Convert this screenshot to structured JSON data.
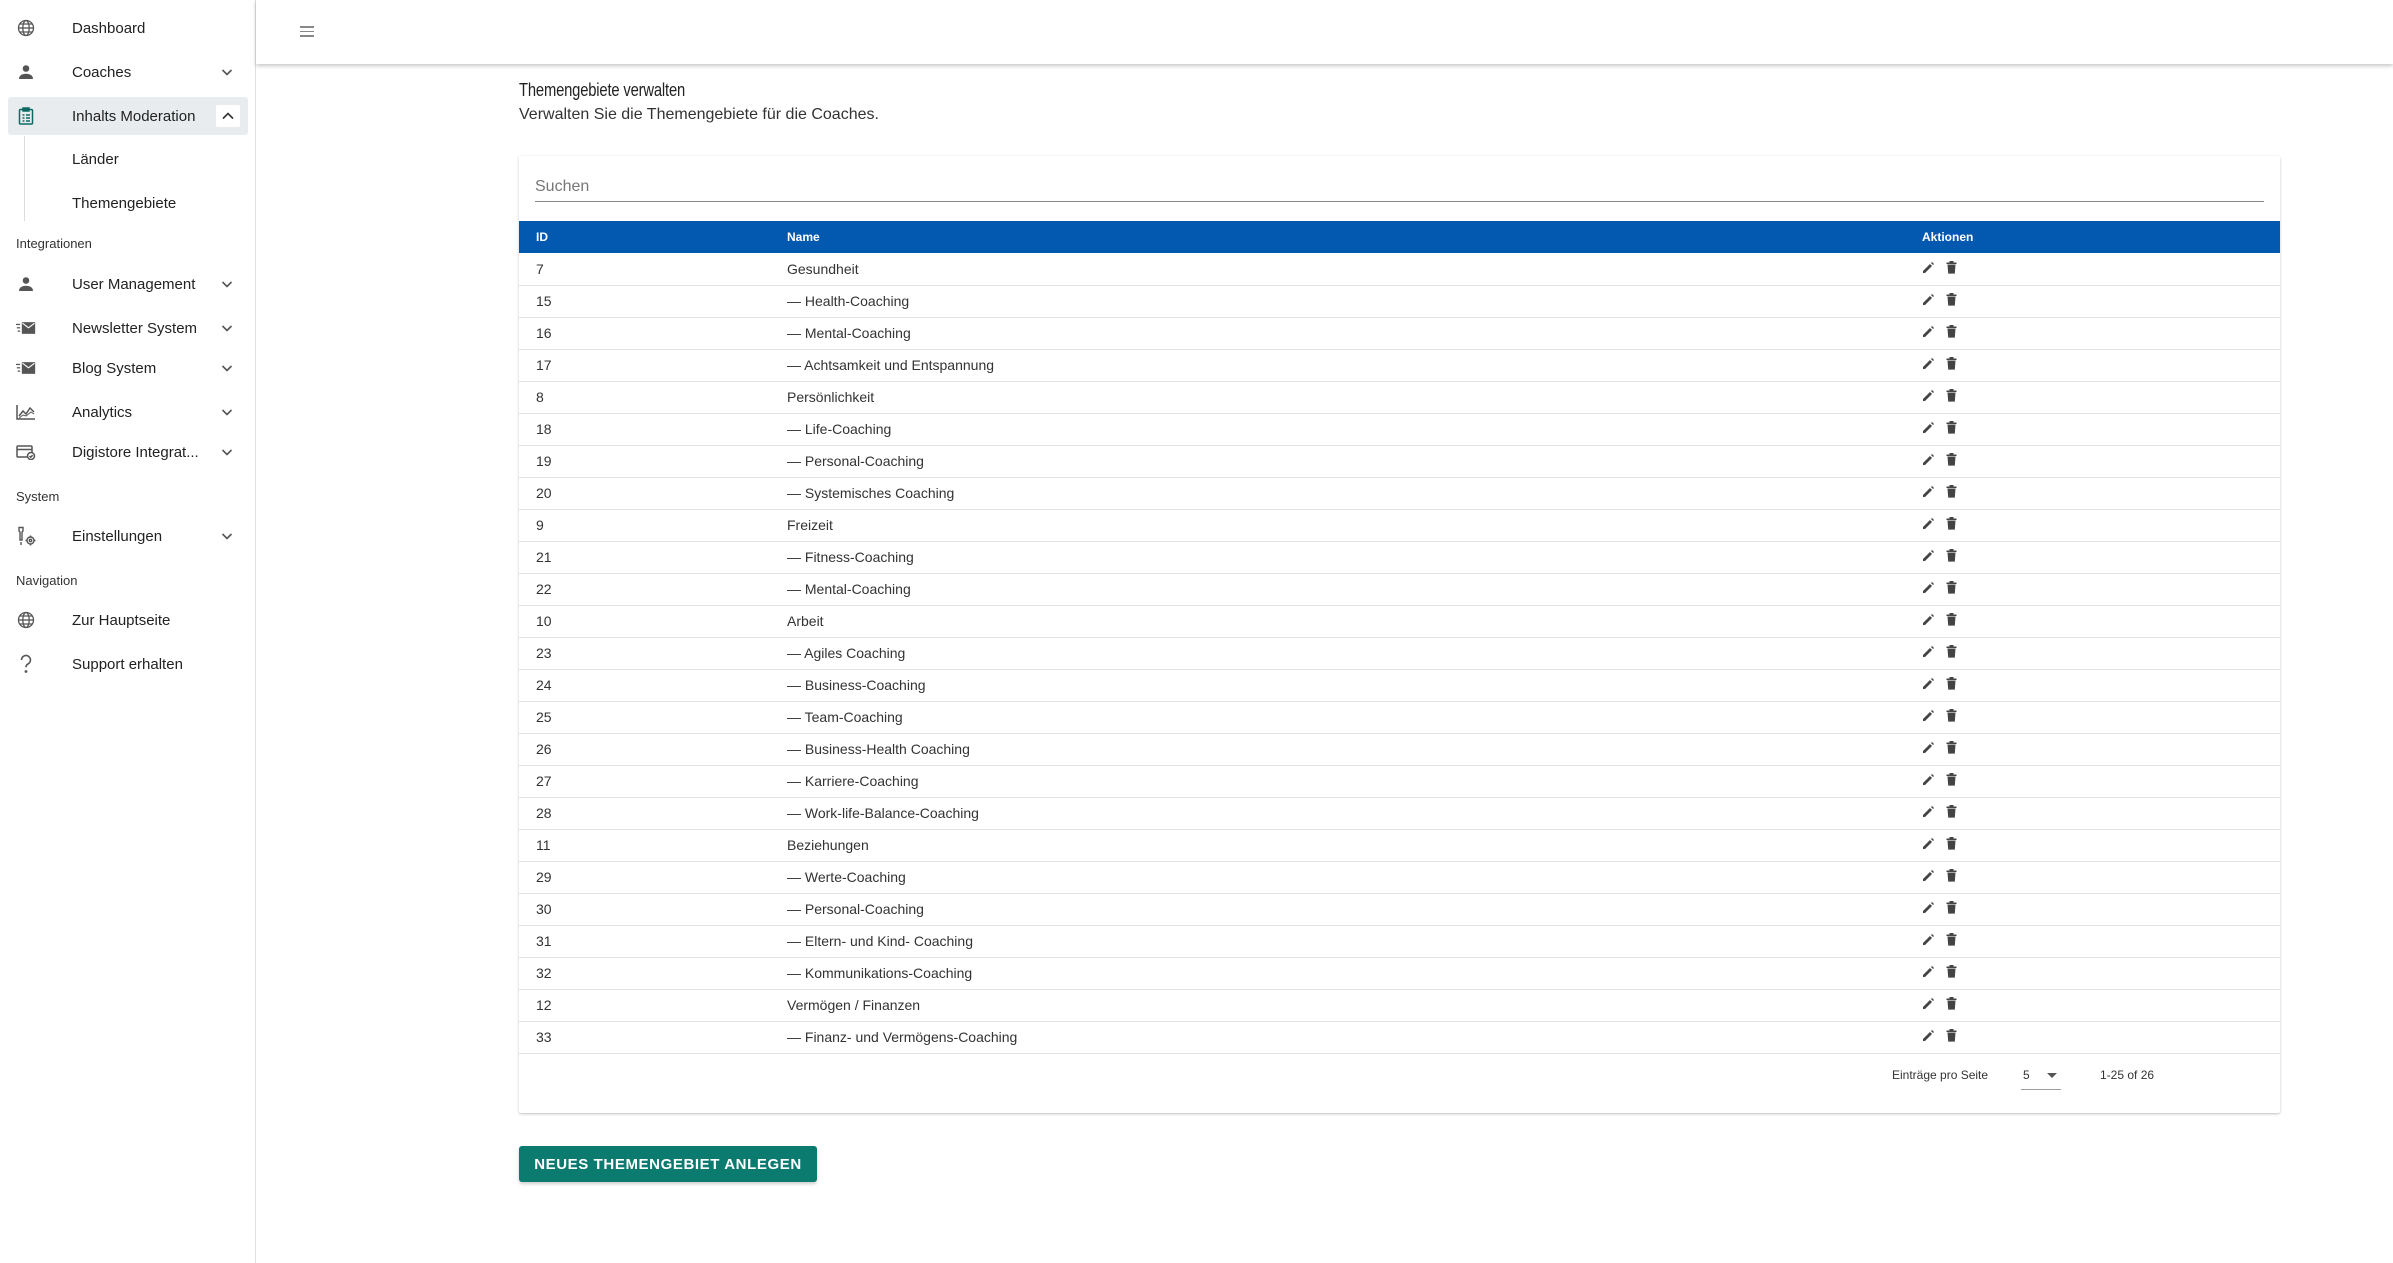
{
  "sidebar": {
    "items": [
      {
        "label": "Dashboard",
        "icon": "globe-icon",
        "expandable": false
      },
      {
        "label": "Coaches",
        "icon": "person-icon",
        "expandable": true
      },
      {
        "label": "Inhalts Moderation",
        "icon": "clipboard-icon",
        "expandable": true,
        "expanded": true,
        "children": [
          "Länder",
          "Themengebiete"
        ]
      }
    ],
    "sections": [
      {
        "label": "Integrationen",
        "items": [
          {
            "label": "User Management",
            "icon": "person-icon"
          },
          {
            "label": "Newsletter System",
            "icon": "mail-icon"
          },
          {
            "label": "Blog System",
            "icon": "mail-icon"
          },
          {
            "label": "Analytics",
            "icon": "chart-icon"
          },
          {
            "label": "Digistore Integrat...",
            "icon": "card-icon"
          }
        ]
      },
      {
        "label": "System",
        "items": [
          {
            "label": "Einstellungen",
            "icon": "tools-icon"
          }
        ]
      },
      {
        "label": "Navigation",
        "items": [
          {
            "label": "Zur Hauptseite",
            "icon": "globe-icon"
          },
          {
            "label": "Support erhalten",
            "icon": "question-icon"
          }
        ]
      }
    ]
  },
  "page": {
    "title": "Themengebiete verwalten",
    "subtitle": "Verwalten Sie die Themengebiete für die Coaches."
  },
  "search": {
    "placeholder": "Suchen",
    "value": ""
  },
  "table": {
    "columns": [
      "ID",
      "Name",
      "Aktionen"
    ],
    "rows": [
      {
        "id": "7",
        "name": "Gesundheit"
      },
      {
        "id": "15",
        "name": "— Health-Coaching"
      },
      {
        "id": "16",
        "name": "— Mental-Coaching"
      },
      {
        "id": "17",
        "name": "— Achtsamkeit und Entspannung"
      },
      {
        "id": "8",
        "name": "Persönlichkeit"
      },
      {
        "id": "18",
        "name": "— Life-Coaching"
      },
      {
        "id": "19",
        "name": "— Personal-Coaching"
      },
      {
        "id": "20",
        "name": "— Systemisches Coaching"
      },
      {
        "id": "9",
        "name": "Freizeit"
      },
      {
        "id": "21",
        "name": "— Fitness-Coaching"
      },
      {
        "id": "22",
        "name": "— Mental-Coaching"
      },
      {
        "id": "10",
        "name": "Arbeit"
      },
      {
        "id": "23",
        "name": "— Agiles Coaching"
      },
      {
        "id": "24",
        "name": "— Business-Coaching"
      },
      {
        "id": "25",
        "name": "— Team-Coaching"
      },
      {
        "id": "26",
        "name": "— Business-Health Coaching"
      },
      {
        "id": "27",
        "name": "— Karriere-Coaching"
      },
      {
        "id": "28",
        "name": "— Work-life-Balance-Coaching"
      },
      {
        "id": "11",
        "name": "Beziehungen"
      },
      {
        "id": "29",
        "name": "— Werte-Coaching"
      },
      {
        "id": "30",
        "name": "— Personal-Coaching"
      },
      {
        "id": "31",
        "name": "— Eltern- und Kind- Coaching"
      },
      {
        "id": "32",
        "name": "— Kommunikations-Coaching"
      },
      {
        "id": "12",
        "name": "Vermögen / Finanzen"
      },
      {
        "id": "33",
        "name": "— Finanz- und Vermögens-Coaching"
      }
    ]
  },
  "pagination": {
    "per_page_label": "Einträge pro Seite",
    "per_page_value": "5",
    "range": "1-25 of 26"
  },
  "actions": {
    "create_label": "NEUES THEMENGEBIET ANLEGEN"
  },
  "colors": {
    "header_blue": "#0358b0",
    "primary_teal": "#0b7a6f",
    "active_bg": "#e9ecef"
  }
}
